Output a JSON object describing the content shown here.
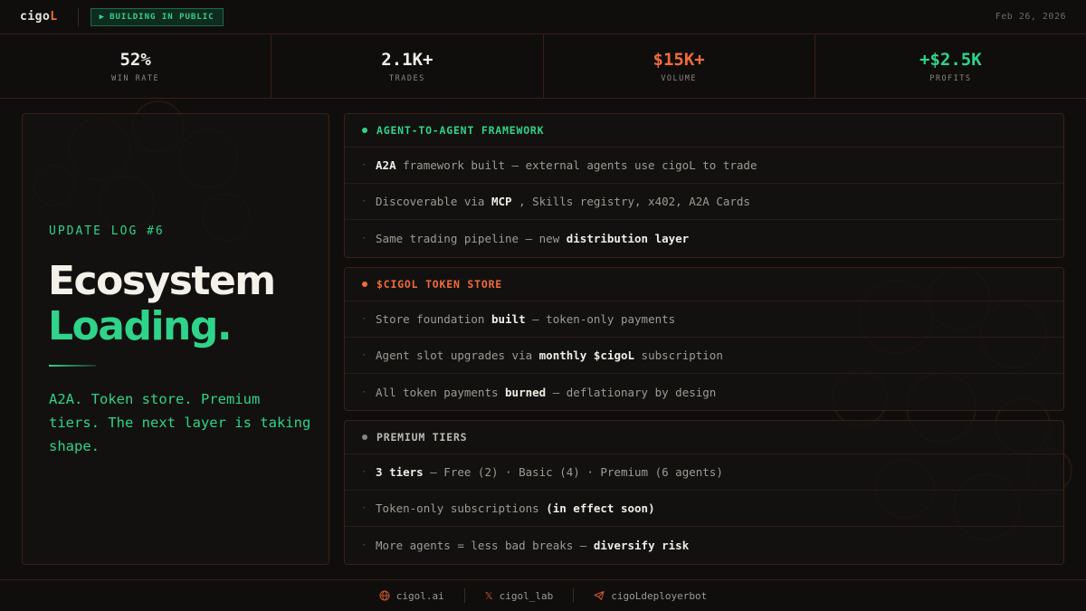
{
  "brand": {
    "logo_main": "cigo",
    "logo_accent": "L",
    "badge": "BUILDING IN PUBLIC",
    "badge_icon": "play-icon"
  },
  "date": "Feb 26, 2026",
  "colors": {
    "accent_orange": "#f26b3a",
    "accent_green": "#2fd38a",
    "background": "#0f0e0d",
    "border": "#3a1f17"
  },
  "stats": [
    {
      "value": "52%",
      "label": "WIN RATE"
    },
    {
      "value": "2.1K+",
      "label": "TRADES"
    },
    {
      "value": "$15K+",
      "label": "VOLUME"
    },
    {
      "value": "+$2.5K",
      "label": "PROFITS"
    }
  ],
  "hero": {
    "kicker": "UPDATE LOG #6",
    "title_line1": "Ecosystem",
    "title_line2": "Loading.",
    "description": "A2A. Token store. Premium tiers. The next layer is taking shape."
  },
  "cards": [
    {
      "title": "AGENT-TO-AGENT FRAMEWORK",
      "rows": [
        {
          "parts": [
            "",
            "A2A",
            " framework built — external agents use cigoL to trade"
          ]
        },
        {
          "parts": [
            "Discoverable via ",
            "MCP",
            " , Skills registry, x402, A2A Cards"
          ]
        },
        {
          "parts": [
            "Same trading pipeline — new ",
            "distribution layer",
            ""
          ]
        }
      ]
    },
    {
      "title": "$CIGOL TOKEN STORE",
      "rows": [
        {
          "parts": [
            "Store foundation ",
            "built",
            " — token-only payments"
          ]
        },
        {
          "parts": [
            "Agent slot upgrades via ",
            "monthly $cigoL",
            " subscription"
          ]
        },
        {
          "parts": [
            "All token payments ",
            "burned",
            " — deflationary by design"
          ]
        }
      ]
    },
    {
      "title": "PREMIUM TIERS",
      "rows": [
        {
          "parts": [
            "",
            "3 tiers",
            " — Free (2) · Basic (4) · Premium (6 agents)"
          ]
        },
        {
          "parts": [
            "Token-only subscriptions ",
            "(in effect soon)",
            ""
          ]
        },
        {
          "parts": [
            "More agents = less bad breaks — ",
            "diversify risk",
            ""
          ]
        }
      ]
    }
  ],
  "footer": [
    {
      "icon": "globe-icon",
      "label": "cigol.ai"
    },
    {
      "icon": "x-logo-icon",
      "label": "cigol_lab"
    },
    {
      "icon": "telegram-icon",
      "label": "cigoLdeployerbot"
    }
  ]
}
